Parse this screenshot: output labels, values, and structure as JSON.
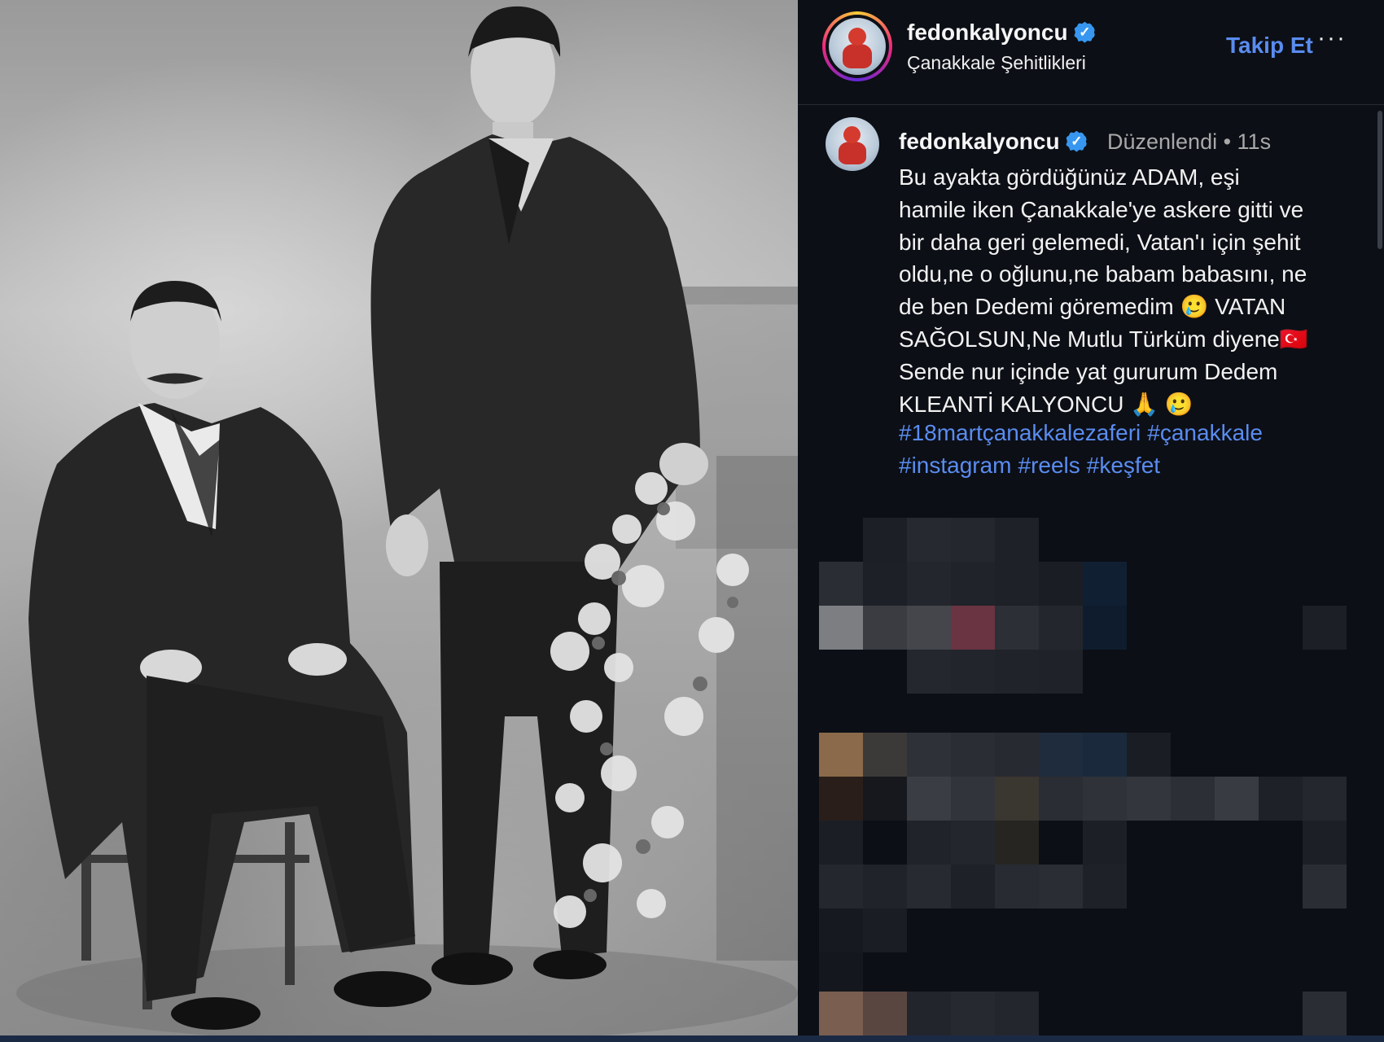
{
  "post": {
    "username": "fedonkalyoncu",
    "verified_glyph": "✓",
    "location": "Çanakkale Şehitlikleri",
    "follow_label": "Takip Et",
    "more_label": "···",
    "icons": [
      "verified-badge-icon",
      "more-options-icon"
    ]
  },
  "caption": {
    "username": "fedonkalyoncu",
    "meta": "Düzenlendi •  11s",
    "text": "Bu ayakta gördüğünüz ADAM, eşi\nhamile iken Çanakkale'ye askere gitti ve\nbir daha geri gelemedi, Vatan'ı için şehit\noldu,ne o oğlunu,ne babam babasını, ne\nde ben Dedemi göremedim 🥲 VATAN\nSAĞOLSUN,Ne Mutlu Türküm diyene🇹🇷\nSende nur içinde yat gururum Dedem\nKLEANTİ KALYONCU 🙏 🥲",
    "hashtags": [
      "#18martçanakkalezaferi",
      "#çanakkale",
      "#instagram",
      "#reels",
      "#keşfet"
    ]
  },
  "colors": {
    "background": "#0c0f16",
    "link_blue": "#5a8cf0",
    "verified_blue": "#3797f0",
    "meta_gray": "#a8a8a8"
  }
}
